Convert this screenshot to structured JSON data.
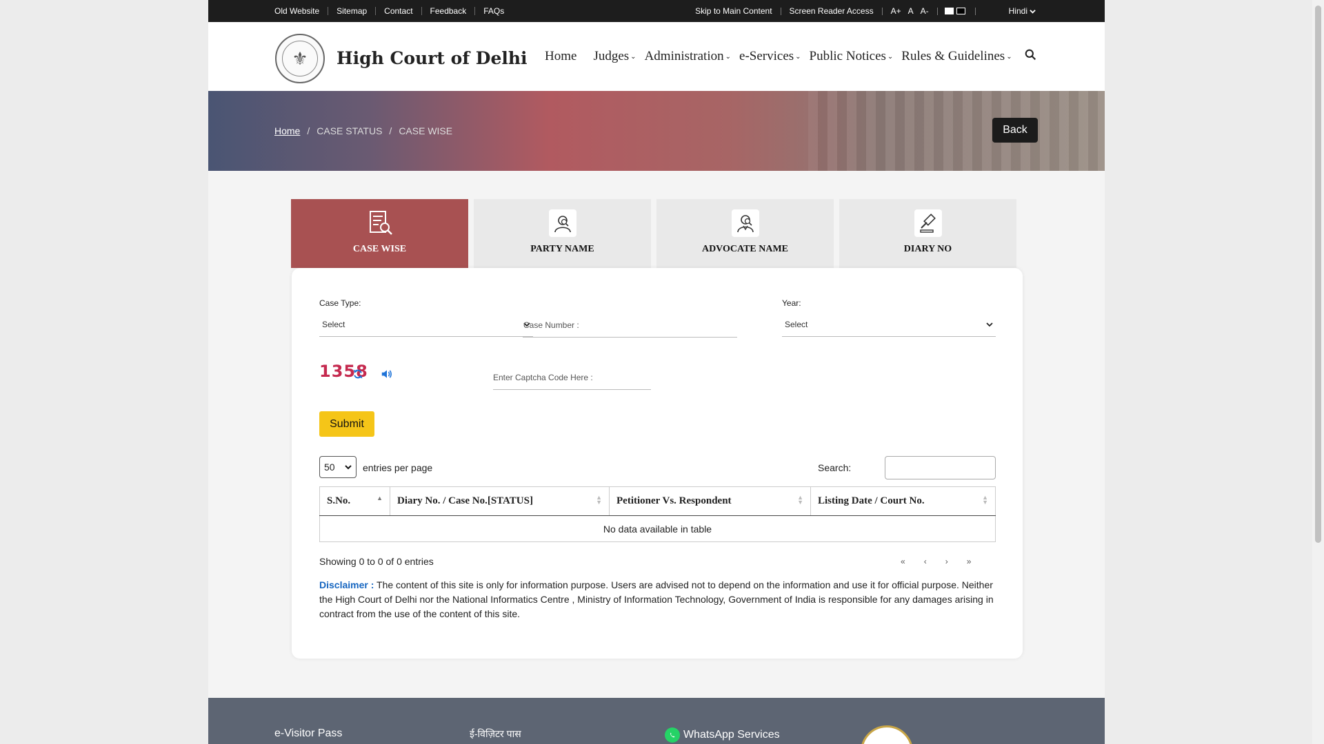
{
  "topbar": {
    "links": [
      "Old Website",
      "Sitemap",
      "Contact",
      "Feedback",
      "FAQs"
    ],
    "skip": "Skip to Main Content",
    "screen_reader": "Screen Reader Access",
    "font_plus": "A+",
    "font_normal": "A",
    "font_minus": "A-",
    "language": "Hindi"
  },
  "header": {
    "site_title": "High Court of Delhi",
    "nav": {
      "home": "Home",
      "judges": "Judges",
      "administration": "Administration",
      "eservices": "e-Services",
      "public_notices": "Public Notices",
      "rules": "Rules & Guidelines"
    }
  },
  "breadcrumb": {
    "home": "Home",
    "sep": "/",
    "case_status": "CASE STATUS",
    "case_wise": "CASE WISE"
  },
  "back_label": "Back",
  "tabs": [
    {
      "label": "CASE WISE",
      "icon": "document-search-icon",
      "active": true
    },
    {
      "label": "PARTY NAME",
      "icon": "party-icon",
      "active": false
    },
    {
      "label": "ADVOCATE NAME",
      "icon": "advocate-icon",
      "active": false
    },
    {
      "label": "DIARY NO",
      "icon": "gavel-icon",
      "active": false
    }
  ],
  "form": {
    "case_type_label": "Case Type:",
    "case_type_value": "Select",
    "case_number_placeholder": "Case Number :",
    "year_label": "Year:",
    "year_value": "Select",
    "captcha_code": "1358",
    "captcha_placeholder": "Enter Captcha Code Here :",
    "submit_label": "Submit"
  },
  "table_controls": {
    "page_length": "50",
    "entries_text": "entries per page",
    "search_label": "Search:"
  },
  "table": {
    "columns": [
      "S.No.",
      "Diary No. / Case No.[STATUS]",
      "Petitioner Vs. Respondent",
      "Listing Date / Court No."
    ],
    "empty_message": "No data available in table",
    "info": "Showing 0 to 0 of 0 entries",
    "pager": {
      "first": "«",
      "prev": "‹",
      "next": "›",
      "last": "»"
    }
  },
  "disclaimer": {
    "heading": "Disclaimer :",
    "text": " The content of this site is only for information purpose. Users are advised not to depend on the information and use it for official purpose. Neither the High Court of Delhi nor the National Informatics Centre , Ministry of Information Technology, Government of India is responsible for any damages arising in contract from the use of the content of this site."
  },
  "footer": {
    "evisitor": "e-Visitor Pass",
    "hindi_item": "ई-विज़िटर पास",
    "whatsapp": "WhatsApp Services"
  },
  "colors": {
    "active_tab": "#a85152",
    "submit": "#f5c518",
    "captcha": "#c52a4f",
    "disclaimer_heading": "#1565c0"
  }
}
